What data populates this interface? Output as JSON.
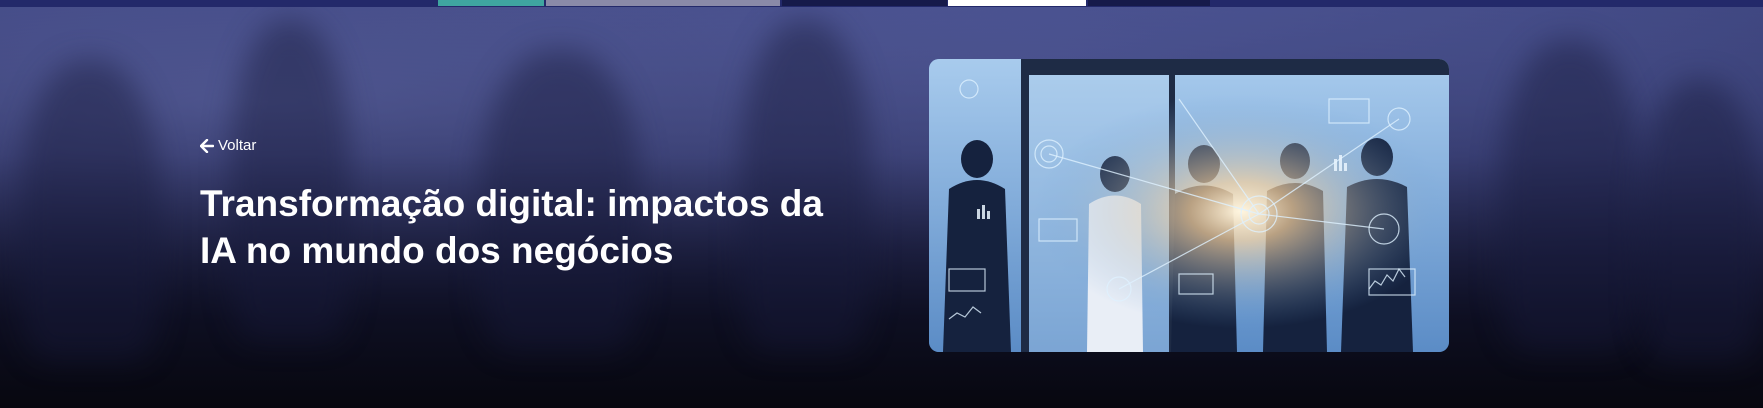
{
  "back": {
    "label": "Voltar",
    "icon": "arrow-left-icon"
  },
  "article": {
    "title": "Transformação digital: impactos da IA no mundo dos negócios"
  },
  "hero_image": {
    "alt": "Pessoas de negócios com interface digital de IA"
  },
  "top_bar": {
    "segments": [
      {
        "color": "#3fa5a0"
      },
      {
        "color": "#8a8aa8"
      },
      {
        "color": "#161a4a"
      },
      {
        "color": "#ffffff"
      },
      {
        "color": "#161a4a"
      }
    ]
  },
  "colors": {
    "background_top": "#2a2f63",
    "background_bottom": "#07070f",
    "text": "#ffffff"
  }
}
